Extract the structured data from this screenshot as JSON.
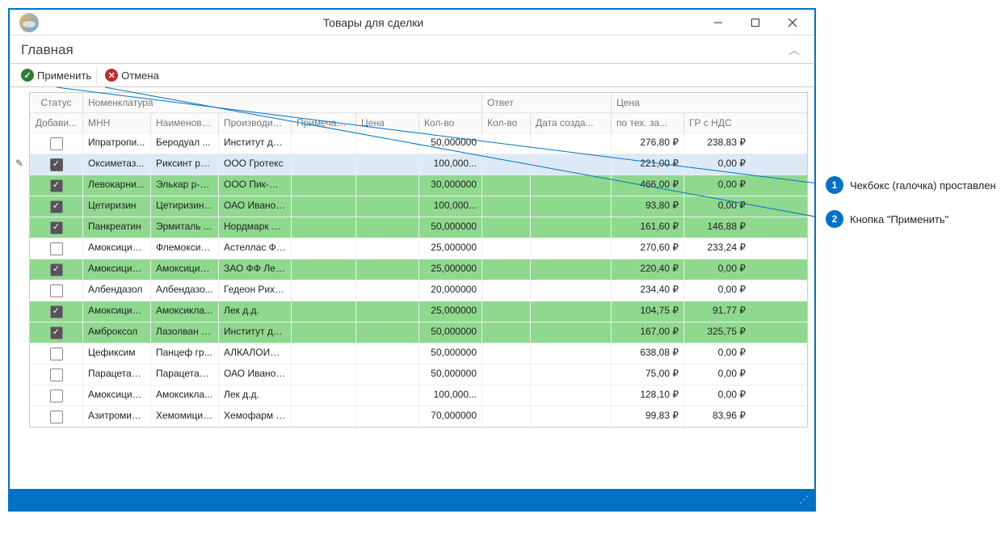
{
  "window": {
    "title": "Товары для сделки"
  },
  "ribbon": {
    "tab": "Главная"
  },
  "toolbar": {
    "apply_label": "Применить",
    "cancel_label": "Отмена"
  },
  "grid": {
    "group_headers": {
      "status": "Статус",
      "nomenclature": "Номенклатура",
      "answer": "Ответ",
      "price": "Цена"
    },
    "sub_headers": {
      "added": "Добави...",
      "mnn": "МНН",
      "name": "Наименова...",
      "producer": "Производите...",
      "note": "Примечание",
      "price": "Цена",
      "quantity": "Кол-во",
      "answer_quantity": "Кол-во",
      "created": "Дата созда...",
      "tech": "по тех. за...",
      "gr": "ГР с НДС"
    },
    "rows": [
      {
        "checked": false,
        "highlight": false,
        "selected": false,
        "mnn": "Ипратропи...",
        "name": "Беродуал ...",
        "producer": "Институт де ...",
        "note": "",
        "price": "",
        "qty": "50,000000",
        "aqty": "",
        "date": "",
        "tech": "276,80 ₽",
        "gr": "238,83 ₽"
      },
      {
        "checked": true,
        "highlight": false,
        "selected": true,
        "mnn": "Оксиметаз...",
        "name": "Риксинт ри...",
        "producer": "ООО Гротекс",
        "note": "",
        "price": "",
        "qty": "100,000...",
        "aqty": "",
        "date": "",
        "tech": "221,00 ₽",
        "gr": "0,00 ₽"
      },
      {
        "checked": true,
        "highlight": true,
        "selected": false,
        "mnn": "Левокарни...",
        "name": "Элькар р-р...",
        "producer": "ООО Пик-Фа...",
        "note": "",
        "price": "",
        "qty": "30,000000",
        "aqty": "",
        "date": "",
        "tech": "466,00 ₽",
        "gr": "0,00 ₽"
      },
      {
        "checked": true,
        "highlight": true,
        "selected": false,
        "mnn": "Цетиризин",
        "name": "Цетиризин...",
        "producer": "ОАО Иванов...",
        "note": "",
        "price": "",
        "qty": "100,000...",
        "aqty": "",
        "date": "",
        "tech": "93,80 ₽",
        "gr": "0,00 ₽"
      },
      {
        "checked": true,
        "highlight": true,
        "selected": false,
        "mnn": "Панкреатин",
        "name": "Эрмиталь ...",
        "producer": "Нордмарк Ар...",
        "note": "",
        "price": "",
        "qty": "50,000000",
        "aqty": "",
        "date": "",
        "tech": "161,60 ₽",
        "gr": "146,88 ₽"
      },
      {
        "checked": false,
        "highlight": false,
        "selected": false,
        "mnn": "Амоксицил...",
        "name": "Флемоксин...",
        "producer": "Астеллас Фа...",
        "note": "",
        "price": "",
        "qty": "25,000000",
        "aqty": "",
        "date": "",
        "tech": "270,60 ₽",
        "gr": "233,24 ₽"
      },
      {
        "checked": true,
        "highlight": true,
        "selected": false,
        "mnn": "Амоксицил...",
        "name": "Амоксицил...",
        "producer": "ЗАО ФФ Лекко",
        "note": "",
        "price": "",
        "qty": "25,000000",
        "aqty": "",
        "date": "",
        "tech": "220,40 ₽",
        "gr": "0,00 ₽"
      },
      {
        "checked": false,
        "highlight": false,
        "selected": false,
        "mnn": "Албендазол",
        "name": "Албендазо...",
        "producer": "Гедеон Рихт...",
        "note": "",
        "price": "",
        "qty": "20,000000",
        "aqty": "",
        "date": "",
        "tech": "234,40 ₽",
        "gr": "0,00 ₽"
      },
      {
        "checked": true,
        "highlight": true,
        "selected": false,
        "mnn": "Амоксицил...",
        "name": "Амоксикла...",
        "producer": "Лек д.д.",
        "note": "",
        "price": "",
        "qty": "25,000000",
        "aqty": "",
        "date": "",
        "tech": "104,75 ₽",
        "gr": "91,77 ₽"
      },
      {
        "checked": true,
        "highlight": true,
        "selected": false,
        "mnn": "Амброксол",
        "name": "Лазолван р...",
        "producer": "Институт де ...",
        "note": "",
        "price": "",
        "qty": "50,000000",
        "aqty": "",
        "date": "",
        "tech": "167,00 ₽",
        "gr": "325,75 ₽"
      },
      {
        "checked": false,
        "highlight": false,
        "selected": false,
        "mnn": "Цефиксим",
        "name": "Панцеф гр...",
        "producer": "АЛКАЛОИД ...",
        "note": "",
        "price": "",
        "qty": "50,000000",
        "aqty": "",
        "date": "",
        "tech": "638,08 ₽",
        "gr": "0,00 ₽"
      },
      {
        "checked": false,
        "highlight": false,
        "selected": false,
        "mnn": "Парацетам...",
        "name": "Парацетам...",
        "producer": "ОАО Иванов...",
        "note": "",
        "price": "",
        "qty": "50,000000",
        "aqty": "",
        "date": "",
        "tech": "75,00 ₽",
        "gr": "0,00 ₽"
      },
      {
        "checked": false,
        "highlight": false,
        "selected": false,
        "mnn": "Амоксицил...",
        "name": "Амоксикла...",
        "producer": "Лек д.д.",
        "note": "",
        "price": "",
        "qty": "100,000...",
        "aqty": "",
        "date": "",
        "tech": "128,10 ₽",
        "gr": "0,00 ₽"
      },
      {
        "checked": false,
        "highlight": false,
        "selected": false,
        "mnn": "Азитромицин",
        "name": "Хемомицин ...",
        "producer": "Хемофарм А.Д.",
        "note": "",
        "price": "",
        "qty": "70,000000",
        "aqty": "",
        "date": "",
        "tech": "99,83 ₽",
        "gr": "83,96 ₽"
      }
    ]
  },
  "callouts": {
    "c1": {
      "num": "1",
      "text": "Чекбокс (галочка) проставлен"
    },
    "c2": {
      "num": "2",
      "text": "Кнопка \"Применить\""
    }
  }
}
